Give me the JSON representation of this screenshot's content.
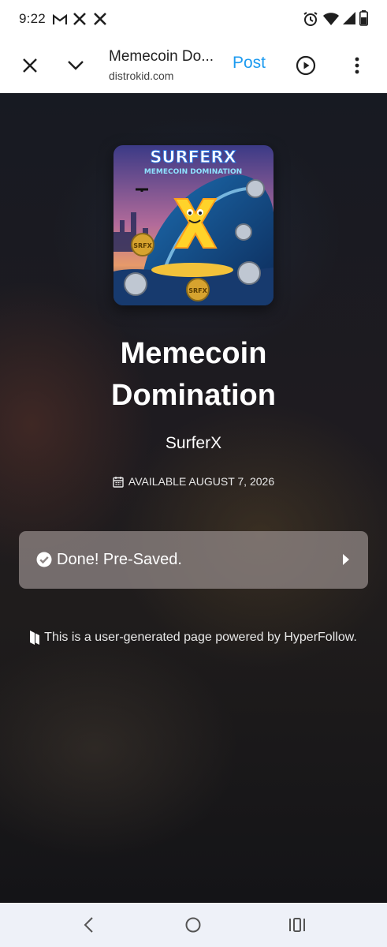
{
  "status_bar": {
    "time": "9:22",
    "left_icons": [
      "gmail-icon",
      "x-icon",
      "x-icon"
    ],
    "right_icons": [
      "alarm-icon",
      "wifi-icon",
      "signal-icon",
      "battery-icon"
    ]
  },
  "toolbar": {
    "title": "Memecoin Do...",
    "domain": "distrokid.com",
    "post_label": "Post",
    "post_color": "#1d9bf0"
  },
  "page": {
    "cover_art": {
      "brand_text": "SURFERX",
      "subtitle_text": "MEMECOIN DOMINATION",
      "coin_text": "SRFX"
    },
    "title_lines": [
      "Memecoin",
      "Domination"
    ],
    "artist": "SurferX",
    "availability": "AVAILABLE AUGUST 7, 2026",
    "presave_label": "Done! Pre-Saved.",
    "footer_note": "This is a user-generated page powered by HyperFollow."
  },
  "navbar": {
    "icons": [
      "back-icon",
      "home-icon",
      "recents-icon"
    ]
  }
}
